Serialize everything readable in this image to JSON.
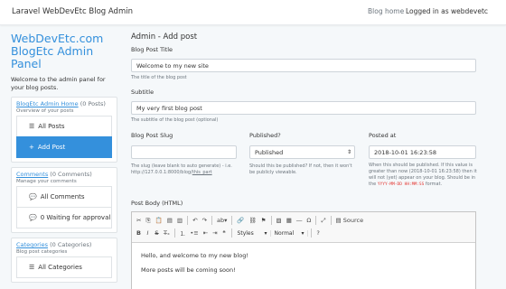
{
  "topbar": {
    "brand": "Laravel WebDevEtc Blog Admin",
    "blog_home": "Blog home",
    "logged_in": "Logged in as webdevetc"
  },
  "sidebar": {
    "title": "WebDevEtc.com BlogEtc Admin Panel",
    "intro": "Welcome to the admin panel for your blog posts.",
    "panels": [
      {
        "link": "BlogEtc Admin Home",
        "count": " (0 Posts)",
        "sub": "Overview of your posts",
        "items": [
          {
            "label": "All Posts",
            "icon": "☰"
          },
          {
            "label": "Add Post",
            "icon": "+"
          }
        ]
      },
      {
        "link": "Comments",
        "count": " (0 Comments)",
        "sub": "Manage your comments",
        "items": [
          {
            "label": "All Comments",
            "icon": "💬"
          },
          {
            "label": "0 Waiting for approval",
            "icon": "💬"
          }
        ]
      },
      {
        "link": "Categories",
        "count": " (0 Categories)",
        "sub": "Blog post categories",
        "items": [
          {
            "label": "All Categories",
            "icon": "☰"
          }
        ]
      }
    ]
  },
  "main": {
    "title": "Admin - Add post",
    "title_label": "Blog Post Title",
    "title_value": "Welcome to my new site",
    "title_help": "The title of the blog post",
    "subtitle_label": "Subtitle",
    "subtitle_value": "My very first blog post",
    "subtitle_help": "The subtitle of the blog post (optional)",
    "slug_label": "Blog Post Slug",
    "slug_value": "",
    "slug_help_1": "The slug (leave blank to auto generate) - i.e.",
    "slug_help_2": "http://127.0.0.1:8000/blog/",
    "slug_help_3": "this_part",
    "published_label": "Published?",
    "published_value": "Published",
    "published_help": "Should this be published? If not, then it won't be publicly viewable.",
    "posted_label": "Posted at",
    "posted_value": "2018-10-01 16:23:58",
    "posted_help_1": "When this should be published. If this value is greater than now (2018-10-01 16:23:58) then it will not (yet) appear on your blog. Should be in the",
    "posted_help_code": "YYYY-MM-DD HH:MM:SS",
    "posted_help_2": "format.",
    "body_label": "Post Body (HTML)",
    "body_lines": [
      "Hello, and welcome to my new blog!",
      "More posts will be coming soon!"
    ]
  },
  "editor": {
    "source_label": "Source",
    "styles_label": "Styles",
    "format_label": "Normal",
    "help_label": "?"
  }
}
